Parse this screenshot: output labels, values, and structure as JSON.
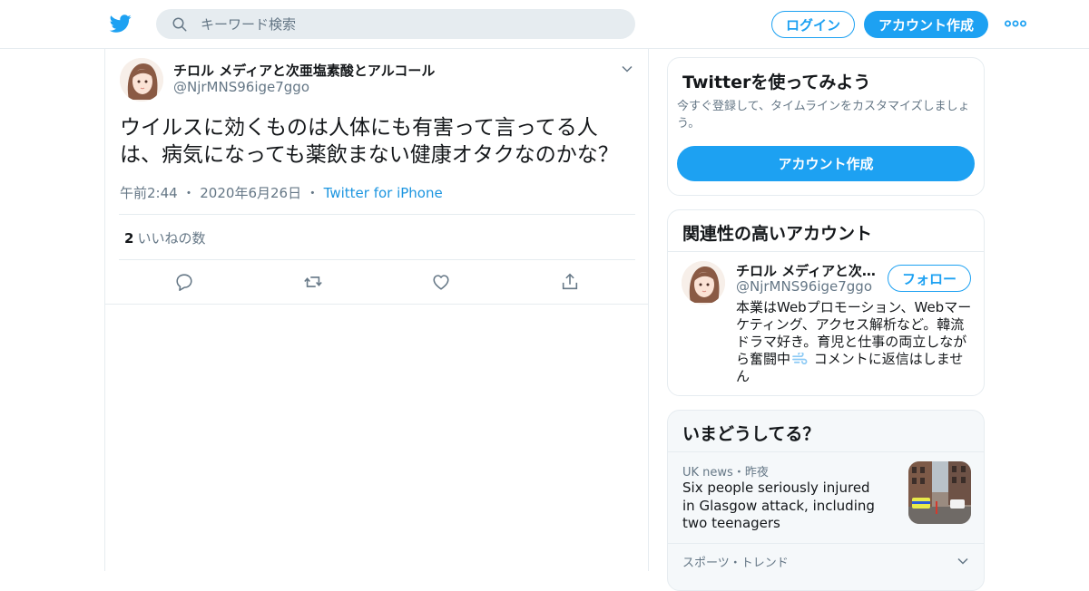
{
  "header": {
    "search_placeholder": "キーワード検索",
    "login_label": "ログイン",
    "signup_label": "アカウント作成"
  },
  "tweet": {
    "author_name": "チロル メディアと次亜塩素酸とアルコール",
    "author_handle": "@NjrMNS96ige7ggo",
    "text": "ウイルスに効くものは人体にも有害って言ってる人は、病気になっても薬飲まない健康オタクなのかな？",
    "time": "午前2:44",
    "date": "2020年6月26日",
    "source": "Twitter for iPhone",
    "likes_count": "2",
    "likes_label": "いいねの数"
  },
  "signup_card": {
    "title": "Twitterを使ってみよう",
    "description": "今すぐ登録して、タイムラインをカスタマイズしましょう。",
    "button_label": "アカウント作成"
  },
  "related": {
    "title": "関連性の高いアカウント",
    "name": "チロル メディアと次亜塩素酸とアルコール",
    "handle": "@NjrMNS96ige7ggo",
    "follow_label": "フォロー",
    "bio_before": "本業はWebプロモーション、Webマーケティング、アクセス解析など。韓流ドラマ好き。育児と仕事の両立しながら奮闘中",
    "bio_after": " コメントに返信はしません"
  },
  "trends": {
    "title": "いまどうしてる？",
    "item1_source": "UK news・昨夜",
    "item1_title": "Six people seriously injured in Glasgow attack, including two teenagers",
    "item2_source": "スポーツ・トレンド"
  },
  "colors": {
    "brand": "#1da1f2",
    "text_secondary": "#657786",
    "border": "#e6ecf0"
  }
}
